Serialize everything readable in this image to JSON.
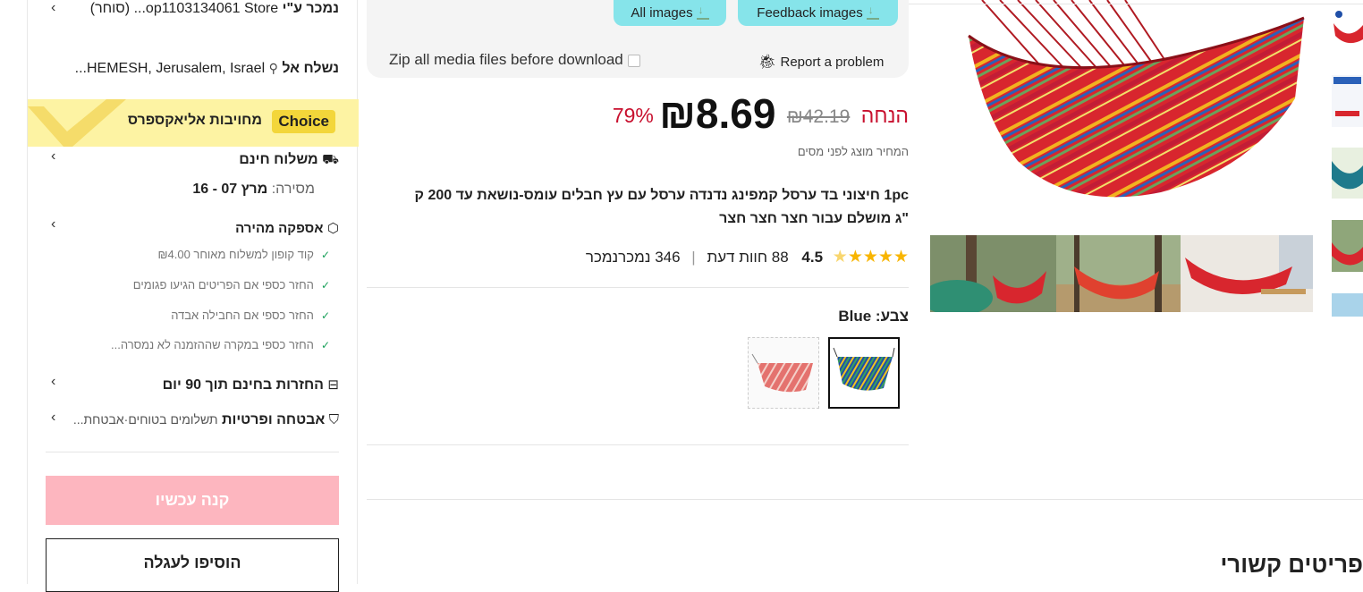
{
  "sidebar": {
    "sold_by_label": "נמכר ע\"י",
    "store_name": "op1103134061 Store...",
    "store_suffix": "(סוחר)",
    "ship_to_label": "נשלח אל",
    "ship_to_value": "HEMESH, Jerusalem, Israel...",
    "choice_badge": "Choice",
    "choice_text": "מחויבות אליאקספרס",
    "free_shipping": "משלוח חינם",
    "delivery_label": "מסירה:",
    "delivery_dates": "מרץ 07 - 16",
    "fast_delivery": "אספקה מהירה",
    "guarantees": [
      "קוד קופון למשלוח מאוחר ₪4.00",
      "החזר כספי אם הפריטים הגיעו פגומים",
      "החזר כספי אם החבילה אבדה",
      "החזר כספי במקרה שההזמנה לא נמסרה..."
    ],
    "returns": "החזרות בחינם תוך 90 יום",
    "security_title": "אבטחה ופרטיות",
    "security_sub": "תשלומים בטוחים·אבטחת...",
    "buy_now": "קנה עכשיו",
    "add_to_cart": "הוסיפו לעגלה"
  },
  "media": {
    "all_images": "All images",
    "feedback_images": "Feedback images",
    "zip_label": "Zip all media files before download",
    "report": "Report a problem"
  },
  "product": {
    "price": "₪8.69",
    "old_price": "₪42.19",
    "discount": "79% הנחה",
    "tax_note": "המחיר מוצג לפני מסים",
    "title_line1": "1pc חיצוני בד ערסל קמפינג נדנדה ערסל עם עץ חבלים עומס-נושאת עד 200 ק",
    "title_line2": "\"ג מושלם עבור חצר חצר חצר",
    "rating": "4.5",
    "reviews": "88 חוות דעת",
    "sold": "346 נמכרנמכר",
    "rating_fraction": 0.9,
    "color_label": "צבע:",
    "color_value": "Blue"
  },
  "related_title": "פריטים קשורים",
  "colors": {
    "price_red": "#c8102e",
    "choice_yellow": "#fdf3a3",
    "buy_pink": "#fdb6bf",
    "media_btn": "#86e4ea"
  }
}
